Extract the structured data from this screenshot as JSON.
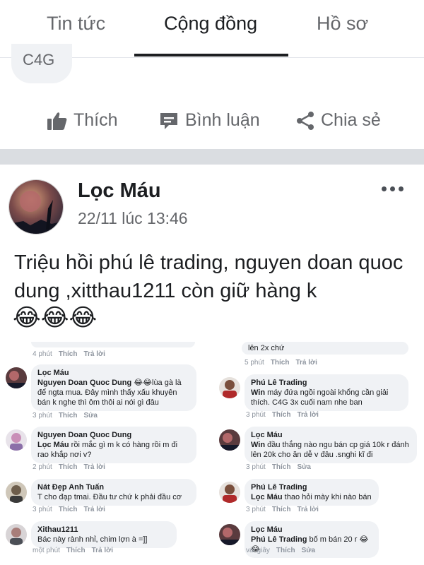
{
  "tabs": [
    {
      "label": "Tin tức"
    },
    {
      "label": "Cộng đồng"
    },
    {
      "label": "Hồ sơ"
    }
  ],
  "prev_post": {
    "chip": "C4G",
    "like": "Thích",
    "comment": "Bình luận",
    "share": "Chia sẻ"
  },
  "post": {
    "author": "Lọc Máu",
    "time": "22/11 lúc 13:46",
    "text": "Triệu hồi phú lê trading, nguyen doan quoc dung ,xitthau1211 còn giữ hàng k",
    "emoji": "😂😂😂"
  },
  "screenshot": {
    "left_top_meta": {
      "time": "4 phút",
      "like": "Thích",
      "reply": "Trả lời"
    },
    "right_top": {
      "text": "lên 2x chứ",
      "time": "5 phút",
      "like": "Thích",
      "reply": "Trả lời"
    },
    "left": [
      {
        "name": "Lọc Máu",
        "tag": "Nguyen Doan Quoc Dung",
        "text": " 😂😂lùa gà là để ngta mua. Đây mình thấy xấu khuyên bán k nghe thì ôm thôi ai nói gì đâu",
        "time": "3 phút",
        "like": "Thích",
        "action": "Sửa"
      },
      {
        "name": "Nguyen Doan Quoc Dung",
        "tag": "Lọc Máu",
        "text": " rồi mắc gì m k có hàng rồi m đi rao khắp nơi v?",
        "time": "2 phút",
        "like": "Thích",
        "action": "Trả lời"
      },
      {
        "name": "Nát Đẹp Anh Tuấn",
        "tag": "",
        "text": "T cho đạp tmai. Đầu tư chứ k phải đầu cơ",
        "time": "3 phút",
        "like": "Thích",
        "action": "Trả lời"
      },
      {
        "name": "Xithau1211",
        "tag": "",
        "text": "Bác này rành nhỉ, chim lợn à =]]",
        "time": "một phút",
        "like": "Thích",
        "action": "Trả lời"
      }
    ],
    "right": [
      {
        "name": "Phú Lê Trading",
        "tag": "Win",
        "text": " máy đứa ngồi ngoài khổng cần giải thích. C4G 3x cuối nam nhe ban",
        "time": "3 phút",
        "like": "Thích",
        "action": "Trả lời"
      },
      {
        "name": "Lọc Máu",
        "tag": "Win",
        "text": " đầu thắng nào ngu bán cp giá 10k r đánh lên 20k cho ăn dễ v đâu .snghi kĩ đi",
        "time": "3 phút",
        "like": "Thích",
        "action": "Sửa"
      },
      {
        "name": "Phú Lê Trading",
        "tag": "Lọc Máu",
        "text": " thao hỏi mày khi nào bán",
        "time": "3 phút",
        "like": "Thích",
        "action": "Trả lời"
      },
      {
        "name": "Lọc Máu",
        "tag": "Phú Lê Trading",
        "text": " bố m bán 20 r 😂😂",
        "time": "vài giây",
        "like": "Thích",
        "action": "Sửa"
      }
    ]
  },
  "colors": {
    "text": "#1c1e21",
    "muted": "#65676b",
    "bubble": "#f0f2f5",
    "separator": "#dadde1"
  }
}
